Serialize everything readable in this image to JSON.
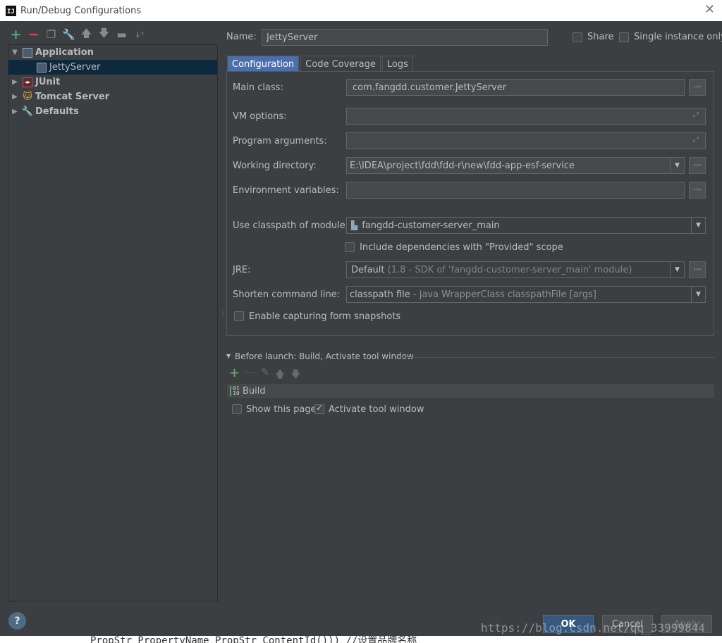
{
  "window": {
    "title": "Run/Debug Configurations",
    "app_logo": "IJ"
  },
  "toolbar": {
    "items": [
      "add-icon",
      "remove-icon",
      "copy-icon",
      "wrench-icon",
      "arrow-up-icon",
      "arrow-down-icon",
      "folder-icon",
      "sort-icon"
    ]
  },
  "tree": {
    "items": [
      {
        "label": "Application",
        "expanded": true,
        "icon": "application-icon"
      },
      {
        "label": "JettyServer",
        "selected": true,
        "icon": "application-config-icon"
      },
      {
        "label": "JUnit",
        "expanded": false,
        "icon": "junit-icon"
      },
      {
        "label": "Tomcat Server",
        "expanded": false,
        "icon": "tomcat-icon"
      },
      {
        "label": "Defaults",
        "expanded": false,
        "icon": "defaults-icon"
      }
    ]
  },
  "name_row": {
    "label": "Name:",
    "value": "JettyServer",
    "share_label": "Share",
    "single_instance_label": "Single instance only"
  },
  "tabs": [
    {
      "label": "Configuration",
      "active": true
    },
    {
      "label": "Code Coverage"
    },
    {
      "label": "Logs"
    }
  ],
  "config": {
    "main_class": {
      "label": "Main class:",
      "value": "com.fangdd.customer.JettyServer"
    },
    "vm_options": {
      "label": "VM options:",
      "value": ""
    },
    "program_arguments": {
      "label": "Program arguments:",
      "value": ""
    },
    "working_directory": {
      "label": "Working directory:",
      "value": "E:\\IDEA\\project\\fdd\\fdd-r\\new\\fdd-app-esf-service"
    },
    "environment_variables": {
      "label": "Environment variables:",
      "value": ""
    },
    "classpath_module": {
      "label": "Use classpath of module:",
      "value": "fangdd-customer-server_main"
    },
    "include_provided": {
      "label": "Include dependencies with \"Provided\" scope",
      "checked": false
    },
    "jre": {
      "label": "JRE:",
      "value": "Default",
      "detail": "(1.8 - SDK of 'fangdd-customer-server_main' module)"
    },
    "shorten_cmd": {
      "label": "Shorten command line:",
      "value": "classpath file",
      "detail": "- java WrapperClass classpathFile [args]"
    },
    "capture_snapshots": {
      "label": "Enable capturing form snapshots",
      "checked": false
    }
  },
  "before_launch": {
    "title": "Before launch: Build, Activate tool window",
    "tasks": [
      "Build"
    ],
    "show_page": {
      "label": "Show this page",
      "checked": false
    },
    "activate_tool_window": {
      "label": "Activate tool window",
      "checked": true
    }
  },
  "buttons": {
    "ok": "OK",
    "cancel": "Cancel",
    "apply": "Apply",
    "help": "?",
    "dots": "..."
  },
  "overlay": {
    "watermark": "https://blog.csdn.net/qq_33999844",
    "code_strip": "PropStr      PropertyName          PropStr         ContentId()))  //设置品牌名称"
  },
  "colors": {
    "accent": "#4b6eaf",
    "ok_button": "#365880",
    "add_green": "#59a869",
    "remove_red": "#c75450",
    "selection": "#0d293e"
  }
}
